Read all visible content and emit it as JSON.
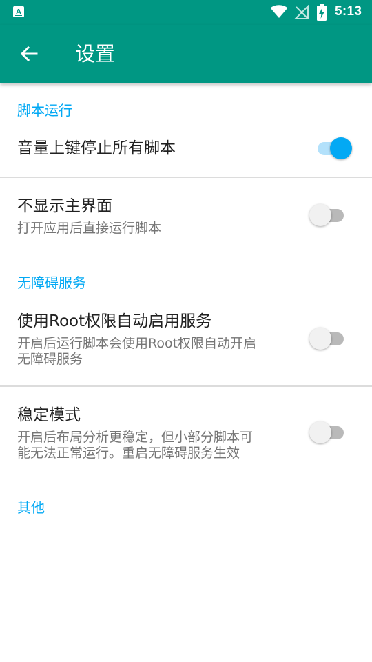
{
  "status_bar": {
    "time": "5:13",
    "icons": [
      "app-notification-icon",
      "wifi-icon",
      "no-signal-icon",
      "battery-charging-icon"
    ]
  },
  "app_bar": {
    "title": "设置",
    "back_icon": "arrow-back-icon"
  },
  "sections": [
    {
      "header": "脚本运行",
      "items": [
        {
          "title": "音量上键停止所有脚本",
          "summary": "",
          "enabled": true
        }
      ]
    },
    {
      "header": "",
      "items": [
        {
          "title": "不显示主界面",
          "summary": "打开应用后直接运行脚本",
          "enabled": false
        }
      ]
    },
    {
      "header": "无障碍服务",
      "items": [
        {
          "title": "使用Root权限自动启用服务",
          "summary_line1": "开启后运行脚本会使用Root权限自动开启",
          "summary_line2": "无障碍服务",
          "enabled": false
        }
      ]
    },
    {
      "header": "",
      "items": [
        {
          "title": "稳定模式",
          "summary_line1": "开启后布局分析更稳定，但小部分脚本可",
          "summary_line2": "能无法正常运行。重启无障碍服务生效",
          "enabled": false
        }
      ]
    },
    {
      "header": "其他",
      "items": []
    }
  ],
  "colors": {
    "primary": "#009783",
    "accent": "#03a9f4",
    "switch_off_track": "#b9b9b9",
    "switch_on_track": "#b3e1fb",
    "title_text": "#212121",
    "summary_text": "#757575"
  }
}
